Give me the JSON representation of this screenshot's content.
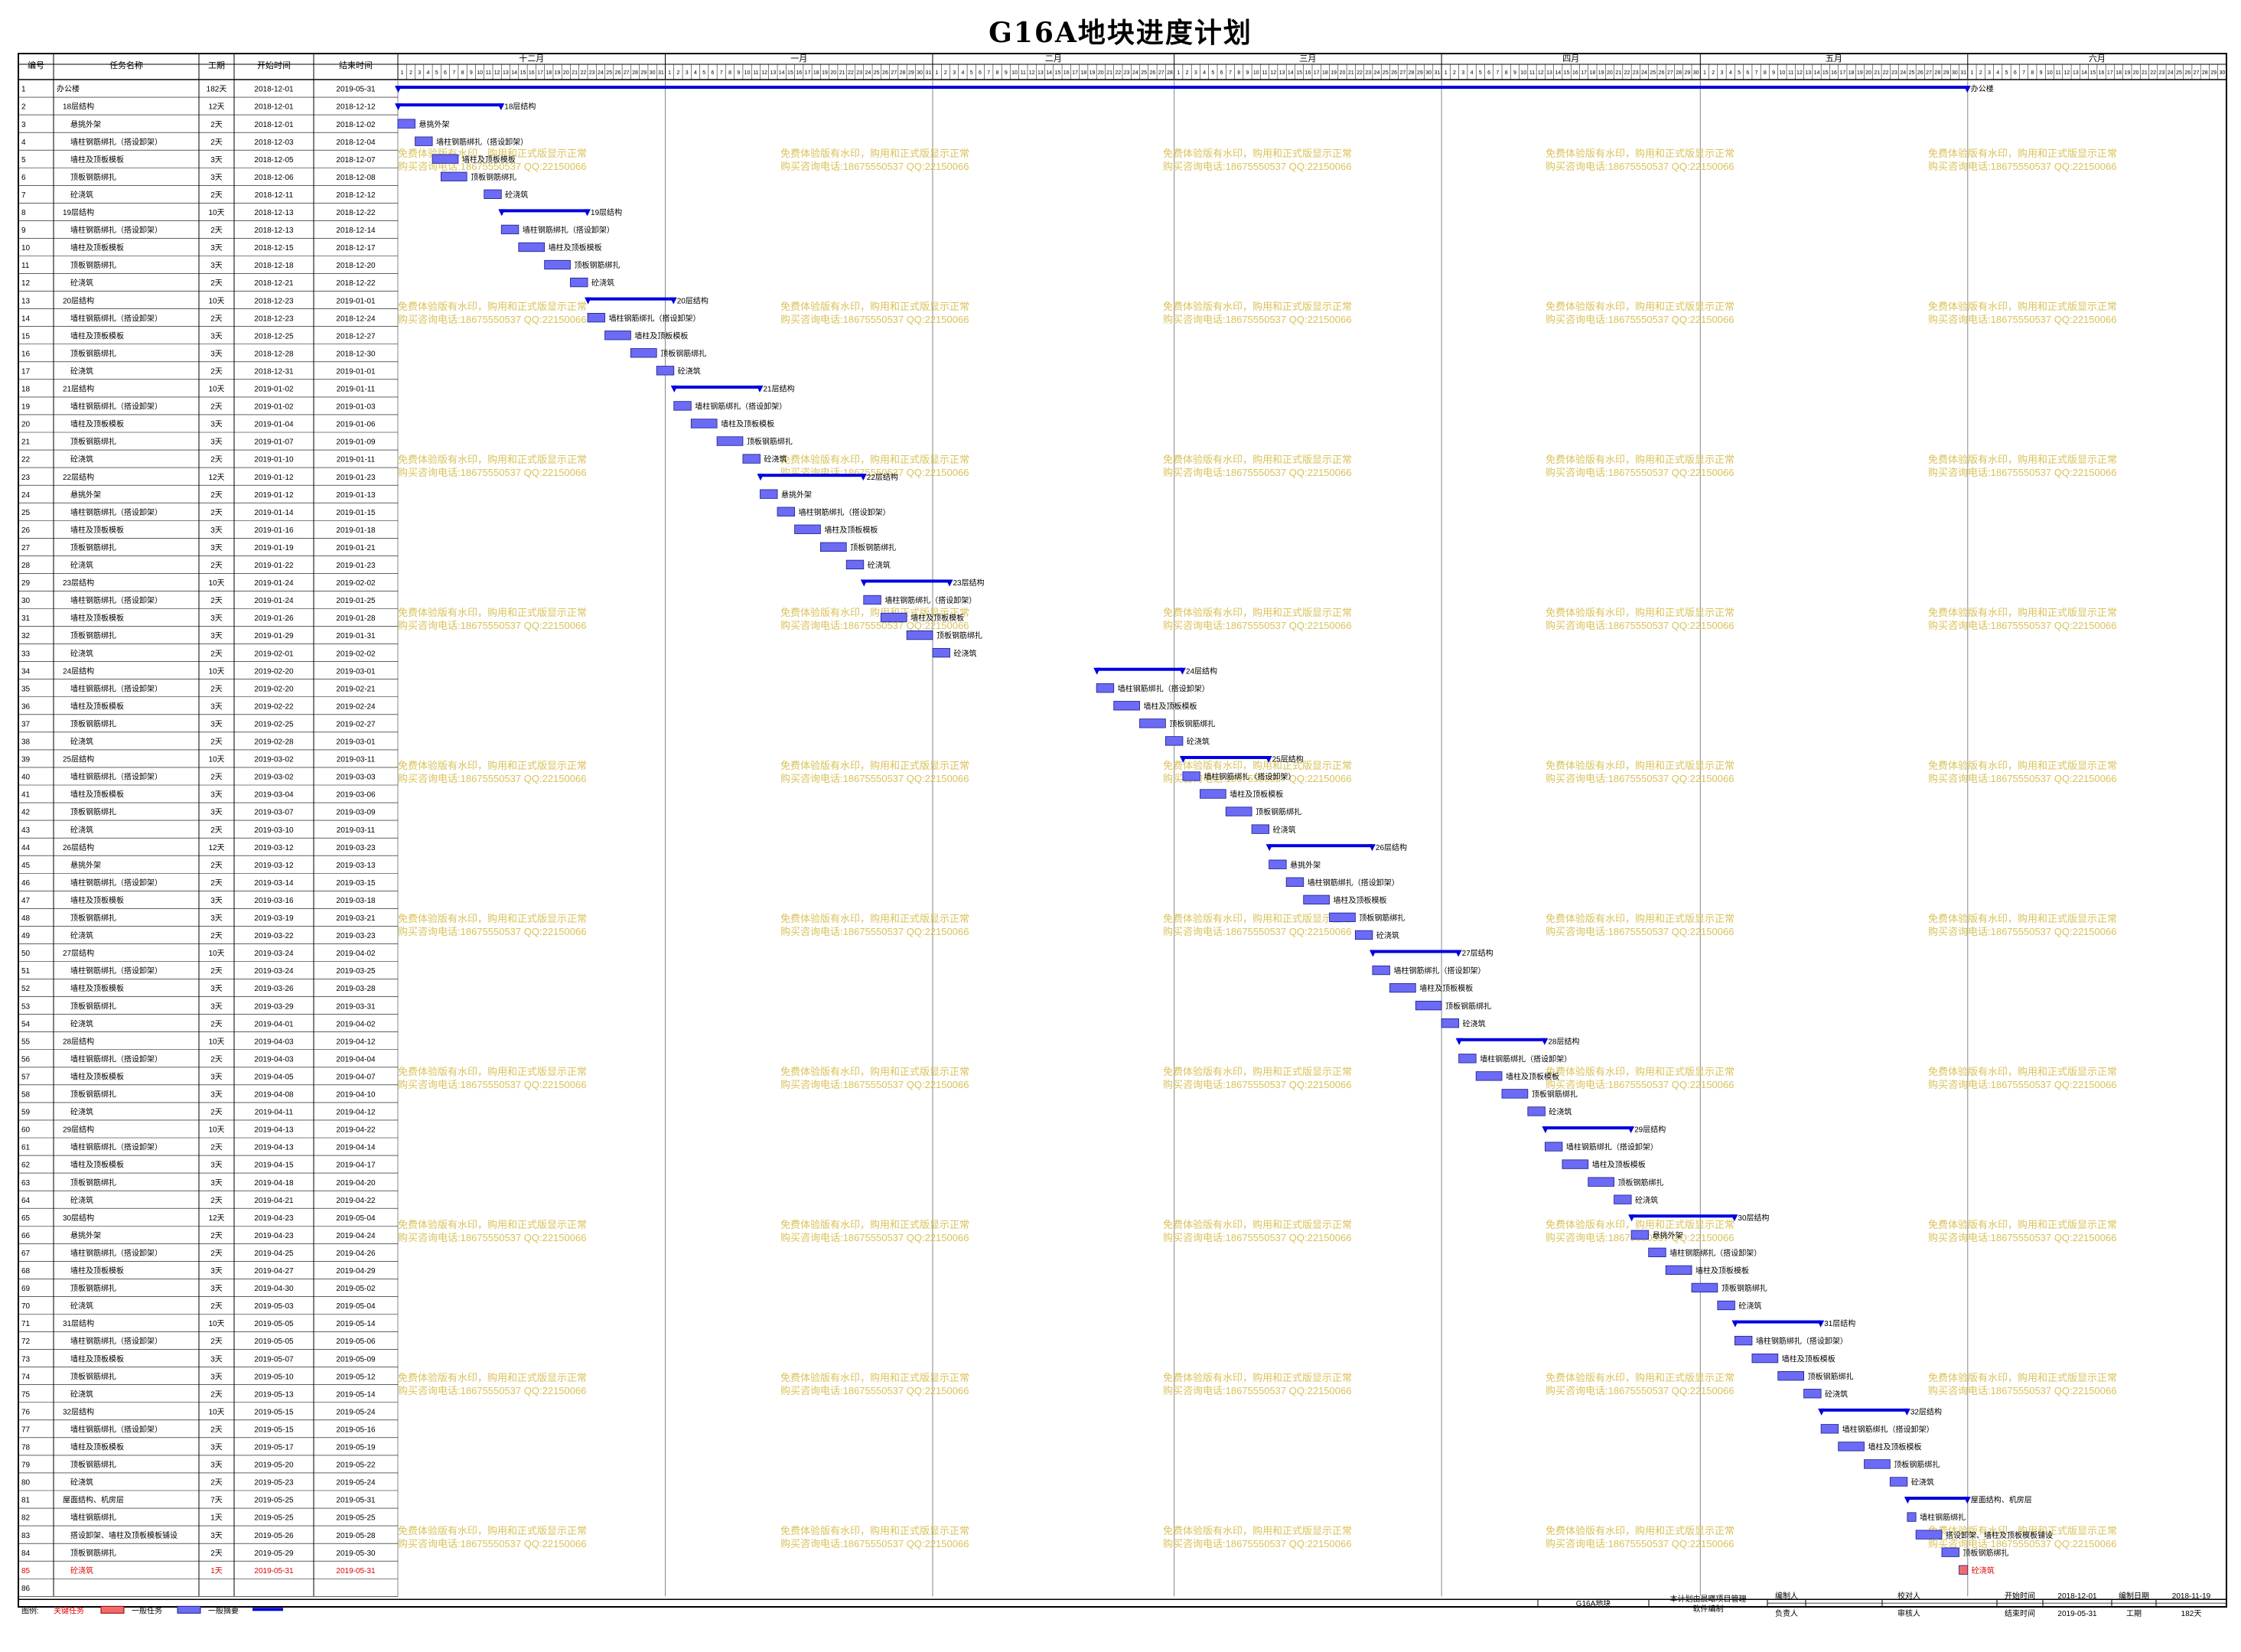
{
  "chart_data": {
    "type": "gantt",
    "title": "G16A地块进度计划",
    "columns": [
      "编号",
      "任务名称",
      "工期",
      "开始时间",
      "结束时间"
    ],
    "months": [
      "十二月",
      "一月",
      "二月",
      "三月",
      "四月",
      "五月",
      "六月"
    ],
    "month_days": [
      31,
      31,
      28,
      31,
      30,
      31,
      30
    ],
    "start_date": "2018-12-01",
    "tasks": [
      {
        "id": "1",
        "name": "办公楼",
        "dur": "182天",
        "start": "2018-12-01",
        "end": "2019-05-31",
        "level": 0,
        "summary": true
      },
      {
        "id": "2",
        "name": "18层结构",
        "dur": "12天",
        "start": "2018-12-01",
        "end": "2018-12-12",
        "level": 1,
        "summary": true
      },
      {
        "id": "3",
        "name": "悬挑外架",
        "dur": "2天",
        "start": "2018-12-01",
        "end": "2018-12-02",
        "level": 2
      },
      {
        "id": "4",
        "name": "墙柱钢筋绑扎（搭设卸架）",
        "dur": "2天",
        "start": "2018-12-03",
        "end": "2018-12-04",
        "level": 2
      },
      {
        "id": "5",
        "name": "墙柱及顶板模板",
        "dur": "3天",
        "start": "2018-12-05",
        "end": "2018-12-07",
        "level": 2
      },
      {
        "id": "6",
        "name": "顶板钢筋绑扎",
        "dur": "3天",
        "start": "2018-12-06",
        "end": "2018-12-08",
        "level": 2
      },
      {
        "id": "7",
        "name": "砼浇筑",
        "dur": "2天",
        "start": "2018-12-11",
        "end": "2018-12-12",
        "level": 2
      },
      {
        "id": "8",
        "name": "19层结构",
        "dur": "10天",
        "start": "2018-12-13",
        "end": "2018-12-22",
        "level": 1,
        "summary": true
      },
      {
        "id": "9",
        "name": "墙柱钢筋绑扎（搭设卸架）",
        "dur": "2天",
        "start": "2018-12-13",
        "end": "2018-12-14",
        "level": 2
      },
      {
        "id": "10",
        "name": "墙柱及顶板模板",
        "dur": "3天",
        "start": "2018-12-15",
        "end": "2018-12-17",
        "level": 2
      },
      {
        "id": "11",
        "name": "顶板钢筋绑扎",
        "dur": "3天",
        "start": "2018-12-18",
        "end": "2018-12-20",
        "level": 2
      },
      {
        "id": "12",
        "name": "砼浇筑",
        "dur": "2天",
        "start": "2018-12-21",
        "end": "2018-12-22",
        "level": 2
      },
      {
        "id": "13",
        "name": "20层结构",
        "dur": "10天",
        "start": "2018-12-23",
        "end": "2019-01-01",
        "level": 1,
        "summary": true
      },
      {
        "id": "14",
        "name": "墙柱钢筋绑扎（搭设卸架）",
        "dur": "2天",
        "start": "2018-12-23",
        "end": "2018-12-24",
        "level": 2
      },
      {
        "id": "15",
        "name": "墙柱及顶板模板",
        "dur": "3天",
        "start": "2018-12-25",
        "end": "2018-12-27",
        "level": 2
      },
      {
        "id": "16",
        "name": "顶板钢筋绑扎",
        "dur": "3天",
        "start": "2018-12-28",
        "end": "2018-12-30",
        "level": 2
      },
      {
        "id": "17",
        "name": "砼浇筑",
        "dur": "2天",
        "start": "2018-12-31",
        "end": "2019-01-01",
        "level": 2
      },
      {
        "id": "18",
        "name": "21层结构",
        "dur": "10天",
        "start": "2019-01-02",
        "end": "2019-01-11",
        "level": 1,
        "summary": true
      },
      {
        "id": "19",
        "name": "墙柱钢筋绑扎（搭设卸架）",
        "dur": "2天",
        "start": "2019-01-02",
        "end": "2019-01-03",
        "level": 2
      },
      {
        "id": "20",
        "name": "墙柱及顶板模板",
        "dur": "3天",
        "start": "2019-01-04",
        "end": "2019-01-06",
        "level": 2
      },
      {
        "id": "21",
        "name": "顶板钢筋绑扎",
        "dur": "3天",
        "start": "2019-01-07",
        "end": "2019-01-09",
        "level": 2
      },
      {
        "id": "22",
        "name": "砼浇筑",
        "dur": "2天",
        "start": "2019-01-10",
        "end": "2019-01-11",
        "level": 2
      },
      {
        "id": "23",
        "name": "22层结构",
        "dur": "12天",
        "start": "2019-01-12",
        "end": "2019-01-23",
        "level": 1,
        "summary": true
      },
      {
        "id": "24",
        "name": "悬挑外架",
        "dur": "2天",
        "start": "2019-01-12",
        "end": "2019-01-13",
        "level": 2
      },
      {
        "id": "25",
        "name": "墙柱钢筋绑扎（搭设卸架）",
        "dur": "2天",
        "start": "2019-01-14",
        "end": "2019-01-15",
        "level": 2
      },
      {
        "id": "26",
        "name": "墙柱及顶板模板",
        "dur": "3天",
        "start": "2019-01-16",
        "end": "2019-01-18",
        "level": 2
      },
      {
        "id": "27",
        "name": "顶板钢筋绑扎",
        "dur": "3天",
        "start": "2019-01-19",
        "end": "2019-01-21",
        "level": 2
      },
      {
        "id": "28",
        "name": "砼浇筑",
        "dur": "2天",
        "start": "2019-01-22",
        "end": "2019-01-23",
        "level": 2
      },
      {
        "id": "29",
        "name": "23层结构",
        "dur": "10天",
        "start": "2019-01-24",
        "end": "2019-02-02",
        "level": 1,
        "summary": true
      },
      {
        "id": "30",
        "name": "墙柱钢筋绑扎（搭设卸架）",
        "dur": "2天",
        "start": "2019-01-24",
        "end": "2019-01-25",
        "level": 2
      },
      {
        "id": "31",
        "name": "墙柱及顶板模板",
        "dur": "3天",
        "start": "2019-01-26",
        "end": "2019-01-28",
        "level": 2
      },
      {
        "id": "32",
        "name": "顶板钢筋绑扎",
        "dur": "3天",
        "start": "2019-01-29",
        "end": "2019-01-31",
        "level": 2
      },
      {
        "id": "33",
        "name": "砼浇筑",
        "dur": "2天",
        "start": "2019-02-01",
        "end": "2019-02-02",
        "level": 2
      },
      {
        "id": "34",
        "name": "24层结构",
        "dur": "10天",
        "start": "2019-02-20",
        "end": "2019-03-01",
        "level": 1,
        "summary": true
      },
      {
        "id": "35",
        "name": "墙柱钢筋绑扎（搭设卸架）",
        "dur": "2天",
        "start": "2019-02-20",
        "end": "2019-02-21",
        "level": 2
      },
      {
        "id": "36",
        "name": "墙柱及顶板模板",
        "dur": "3天",
        "start": "2019-02-22",
        "end": "2019-02-24",
        "level": 2
      },
      {
        "id": "37",
        "name": "顶板钢筋绑扎",
        "dur": "3天",
        "start": "2019-02-25",
        "end": "2019-02-27",
        "level": 2
      },
      {
        "id": "38",
        "name": "砼浇筑",
        "dur": "2天",
        "start": "2019-02-28",
        "end": "2019-03-01",
        "level": 2
      },
      {
        "id": "39",
        "name": "25层结构",
        "dur": "10天",
        "start": "2019-03-02",
        "end": "2019-03-11",
        "level": 1,
        "summary": true
      },
      {
        "id": "40",
        "name": "墙柱钢筋绑扎（搭设卸架）",
        "dur": "2天",
        "start": "2019-03-02",
        "end": "2019-03-03",
        "level": 2
      },
      {
        "id": "41",
        "name": "墙柱及顶板模板",
        "dur": "3天",
        "start": "2019-03-04",
        "end": "2019-03-06",
        "level": 2
      },
      {
        "id": "42",
        "name": "顶板钢筋绑扎",
        "dur": "3天",
        "start": "2019-03-07",
        "end": "2019-03-09",
        "level": 2
      },
      {
        "id": "43",
        "name": "砼浇筑",
        "dur": "2天",
        "start": "2019-03-10",
        "end": "2019-03-11",
        "level": 2
      },
      {
        "id": "44",
        "name": "26层结构",
        "dur": "12天",
        "start": "2019-03-12",
        "end": "2019-03-23",
        "level": 1,
        "summary": true
      },
      {
        "id": "45",
        "name": "悬挑外架",
        "dur": "2天",
        "start": "2019-03-12",
        "end": "2019-03-13",
        "level": 2
      },
      {
        "id": "46",
        "name": "墙柱钢筋绑扎（搭设卸架）",
        "dur": "2天",
        "start": "2019-03-14",
        "end": "2019-03-15",
        "level": 2
      },
      {
        "id": "47",
        "name": "墙柱及顶板模板",
        "dur": "3天",
        "start": "2019-03-16",
        "end": "2019-03-18",
        "level": 2
      },
      {
        "id": "48",
        "name": "顶板钢筋绑扎",
        "dur": "3天",
        "start": "2019-03-19",
        "end": "2019-03-21",
        "level": 2
      },
      {
        "id": "49",
        "name": "砼浇筑",
        "dur": "2天",
        "start": "2019-03-22",
        "end": "2019-03-23",
        "level": 2
      },
      {
        "id": "50",
        "name": "27层结构",
        "dur": "10天",
        "start": "2019-03-24",
        "end": "2019-04-02",
        "level": 1,
        "summary": true
      },
      {
        "id": "51",
        "name": "墙柱钢筋绑扎（搭设卸架）",
        "dur": "2天",
        "start": "2019-03-24",
        "end": "2019-03-25",
        "level": 2
      },
      {
        "id": "52",
        "name": "墙柱及顶板模板",
        "dur": "3天",
        "start": "2019-03-26",
        "end": "2019-03-28",
        "level": 2
      },
      {
        "id": "53",
        "name": "顶板钢筋绑扎",
        "dur": "3天",
        "start": "2019-03-29",
        "end": "2019-03-31",
        "level": 2
      },
      {
        "id": "54",
        "name": "砼浇筑",
        "dur": "2天",
        "start": "2019-04-01",
        "end": "2019-04-02",
        "level": 2
      },
      {
        "id": "55",
        "name": "28层结构",
        "dur": "10天",
        "start": "2019-04-03",
        "end": "2019-04-12",
        "level": 1,
        "summary": true
      },
      {
        "id": "56",
        "name": "墙柱钢筋绑扎（搭设卸架）",
        "dur": "2天",
        "start": "2019-04-03",
        "end": "2019-04-04",
        "level": 2
      },
      {
        "id": "57",
        "name": "墙柱及顶板模板",
        "dur": "3天",
        "start": "2019-04-05",
        "end": "2019-04-07",
        "level": 2
      },
      {
        "id": "58",
        "name": "顶板钢筋绑扎",
        "dur": "3天",
        "start": "2019-04-08",
        "end": "2019-04-10",
        "level": 2
      },
      {
        "id": "59",
        "name": "砼浇筑",
        "dur": "2天",
        "start": "2019-04-11",
        "end": "2019-04-12",
        "level": 2
      },
      {
        "id": "60",
        "name": "29层结构",
        "dur": "10天",
        "start": "2019-04-13",
        "end": "2019-04-22",
        "level": 1,
        "summary": true
      },
      {
        "id": "61",
        "name": "墙柱钢筋绑扎（搭设卸架）",
        "dur": "2天",
        "start": "2019-04-13",
        "end": "2019-04-14",
        "level": 2
      },
      {
        "id": "62",
        "name": "墙柱及顶板模板",
        "dur": "3天",
        "start": "2019-04-15",
        "end": "2019-04-17",
        "level": 2
      },
      {
        "id": "63",
        "name": "顶板钢筋绑扎",
        "dur": "3天",
        "start": "2019-04-18",
        "end": "2019-04-20",
        "level": 2
      },
      {
        "id": "64",
        "name": "砼浇筑",
        "dur": "2天",
        "start": "2019-04-21",
        "end": "2019-04-22",
        "level": 2
      },
      {
        "id": "65",
        "name": "30层结构",
        "dur": "12天",
        "start": "2019-04-23",
        "end": "2019-05-04",
        "level": 1,
        "summary": true
      },
      {
        "id": "66",
        "name": "悬挑外架",
        "dur": "2天",
        "start": "2019-04-23",
        "end": "2019-04-24",
        "level": 2
      },
      {
        "id": "67",
        "name": "墙柱钢筋绑扎（搭设卸架）",
        "dur": "2天",
        "start": "2019-04-25",
        "end": "2019-04-26",
        "level": 2
      },
      {
        "id": "68",
        "name": "墙柱及顶板模板",
        "dur": "3天",
        "start": "2019-04-27",
        "end": "2019-04-29",
        "level": 2
      },
      {
        "id": "69",
        "name": "顶板钢筋绑扎",
        "dur": "3天",
        "start": "2019-04-30",
        "end": "2019-05-02",
        "level": 2
      },
      {
        "id": "70",
        "name": "砼浇筑",
        "dur": "2天",
        "start": "2019-05-03",
        "end": "2019-05-04",
        "level": 2
      },
      {
        "id": "71",
        "name": "31层结构",
        "dur": "10天",
        "start": "2019-05-05",
        "end": "2019-05-14",
        "level": 1,
        "summary": true
      },
      {
        "id": "72",
        "name": "墙柱钢筋绑扎（搭设卸架）",
        "dur": "2天",
        "start": "2019-05-05",
        "end": "2019-05-06",
        "level": 2
      },
      {
        "id": "73",
        "name": "墙柱及顶板模板",
        "dur": "3天",
        "start": "2019-05-07",
        "end": "2019-05-09",
        "level": 2
      },
      {
        "id": "74",
        "name": "顶板钢筋绑扎",
        "dur": "3天",
        "start": "2019-05-10",
        "end": "2019-05-12",
        "level": 2
      },
      {
        "id": "75",
        "name": "砼浇筑",
        "dur": "2天",
        "start": "2019-05-13",
        "end": "2019-05-14",
        "level": 2
      },
      {
        "id": "76",
        "name": "32层结构",
        "dur": "10天",
        "start": "2019-05-15",
        "end": "2019-05-24",
        "level": 1,
        "summary": true
      },
      {
        "id": "77",
        "name": "墙柱钢筋绑扎（搭设卸架）",
        "dur": "2天",
        "start": "2019-05-15",
        "end": "2019-05-16",
        "level": 2
      },
      {
        "id": "78",
        "name": "墙柱及顶板模板",
        "dur": "3天",
        "start": "2019-05-17",
        "end": "2019-05-19",
        "level": 2
      },
      {
        "id": "79",
        "name": "顶板钢筋绑扎",
        "dur": "3天",
        "start": "2019-05-20",
        "end": "2019-05-22",
        "level": 2
      },
      {
        "id": "80",
        "name": "砼浇筑",
        "dur": "2天",
        "start": "2019-05-23",
        "end": "2019-05-24",
        "level": 2
      },
      {
        "id": "81",
        "name": "屋面结构、机房层",
        "dur": "7天",
        "start": "2019-05-25",
        "end": "2019-05-31",
        "level": 1,
        "summary": true
      },
      {
        "id": "82",
        "name": "墙柱钢筋绑扎",
        "dur": "1天",
        "start": "2019-05-25",
        "end": "2019-05-25",
        "level": 2
      },
      {
        "id": "83",
        "name": "搭设卸架、墙柱及顶板模板铺设",
        "dur": "3天",
        "start": "2019-05-26",
        "end": "2019-05-28",
        "level": 2
      },
      {
        "id": "84",
        "name": "顶板钢筋绑扎",
        "dur": "2天",
        "start": "2019-05-29",
        "end": "2019-05-30",
        "level": 2
      },
      {
        "id": "85",
        "name": "砼浇筑",
        "dur": "1天",
        "start": "2019-05-31",
        "end": "2019-05-31",
        "level": 2,
        "critical": true
      },
      {
        "id": "86",
        "name": "",
        "dur": "",
        "start": "",
        "end": "",
        "level": 2
      }
    ],
    "legend": {
      "label": "图例:",
      "critical": "关键任务",
      "normal": "一般任务",
      "summary": "一般摘要"
    },
    "colors": {
      "task": "#6b6bf5",
      "critical": "#f26b6b",
      "summary": "#0000e0",
      "watermark": "#d9c25a",
      "grid": "#999999"
    }
  },
  "watermark": {
    "line1": "免费体验版有水印，购用和正式版显示正常",
    "line2": "购买咨询电话:18675550537 QQ:22150066"
  },
  "footer": {
    "project": "G16A地块",
    "software": "本计划由晨曦项目管理软件编制",
    "compiler_label": "编制人",
    "compiler": "",
    "responsible_label": "负责人",
    "responsible": "",
    "checker_label": "校对人",
    "checker": "",
    "reviewer_label": "审核人",
    "reviewer": "",
    "start_label": "开始时间",
    "start_value": "2018-12-01",
    "end_label": "结束时间",
    "end_value": "2019-05-31",
    "date_label": "编制日期",
    "date_value": "2018-11-19",
    "duration_label": "工期",
    "duration_value": "182天"
  }
}
